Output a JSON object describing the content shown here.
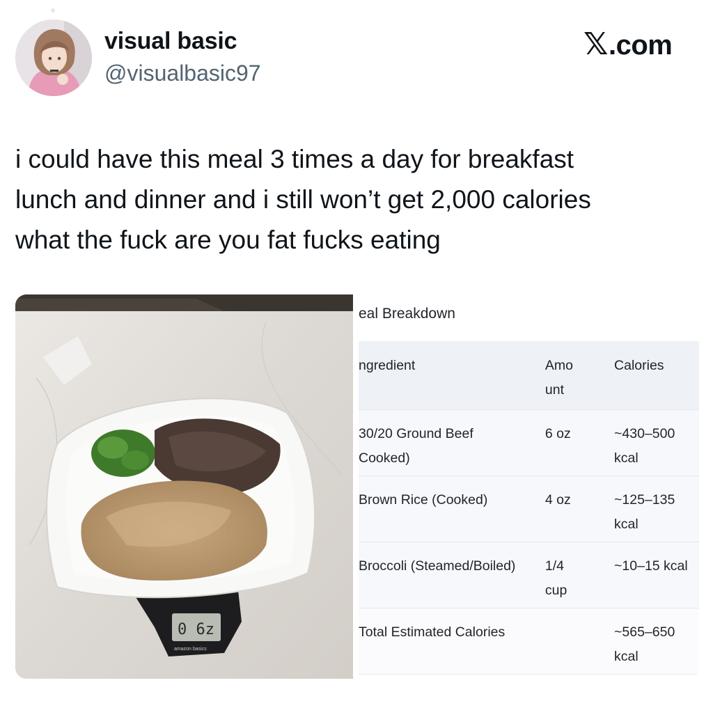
{
  "author": {
    "display_name": "visual basic",
    "handle": "@visualbasic97",
    "avatar_icon": "avatar-illustration"
  },
  "brand": {
    "mark": "𝕏",
    "suffix": ".com"
  },
  "tweet": {
    "lines": [
      "i could have this meal 3 times a day for breakfast",
      "lunch and dinner and i still won’t get 2,000 calories",
      "what the fuck are you fat fucks eating"
    ]
  },
  "media": {
    "photo": {
      "description_icon": "meal-on-scale-photo",
      "scale_readout": "0 6z",
      "scale_brand": "amazon basics"
    },
    "screenshot": {
      "title": "eal Breakdown",
      "headers": [
        "ngredient",
        "Amo\nunt",
        "Calories"
      ],
      "rows": [
        {
          "ingredient": "30/20 Ground Beef\nCooked)",
          "amount": "6 oz",
          "calories": "~430–500\nkcal"
        },
        {
          "ingredient": "Brown Rice (Cooked)",
          "amount": "4 oz",
          "calories": "~125–135\nkcal"
        },
        {
          "ingredient": "Broccoli (Steamed/Boiled)",
          "amount": "1/4\ncup",
          "calories": "~10–15 kcal"
        },
        {
          "ingredient": "Total Estimated Calories",
          "amount": "",
          "calories": "~565–650\nkcal"
        }
      ]
    }
  },
  "colors": {
    "text": "#0f1419",
    "muted": "#536471",
    "table_header_bg": "#eef1f6",
    "table_row_bg": "#f7f8fb"
  }
}
